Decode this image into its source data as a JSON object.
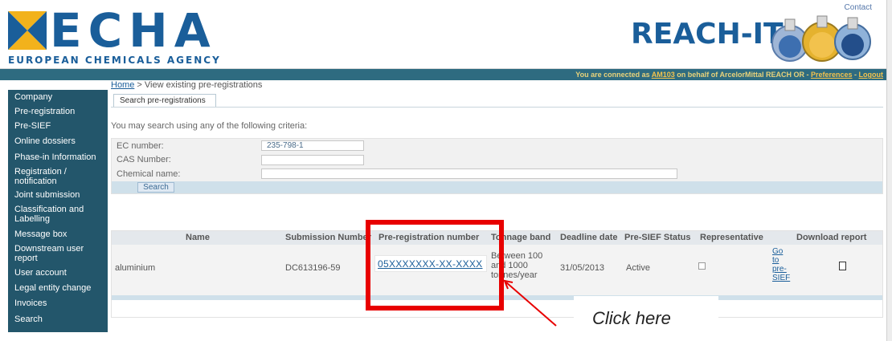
{
  "header": {
    "logo_text": "ECHA",
    "logo_subtitle": "EUROPEAN CHEMICALS AGENCY",
    "app_title": "REACH-IT",
    "contact_link": "Contact"
  },
  "connection": {
    "prefix": "You are connected as ",
    "user": "AM103",
    "middle": " on behalf of ArcelorMittal REACH OR - ",
    "preferences": "Preferences",
    "sep": " - ",
    "logout": "Logout"
  },
  "sidebar": {
    "items": [
      {
        "label": "Company",
        "lines": 1
      },
      {
        "label": "Pre-registration",
        "lines": 1
      },
      {
        "label": "Pre-SIEF",
        "lines": 1
      },
      {
        "label": "Online dossiers",
        "lines": 1
      },
      {
        "label": "Phase-in Information",
        "lines": 1
      },
      {
        "label": "Registration / notification",
        "lines": 2
      },
      {
        "label": "Joint submission",
        "lines": 1
      },
      {
        "label": "Classification and Labelling",
        "lines": 2
      },
      {
        "label": "Message box",
        "lines": 1
      },
      {
        "label": "Downstream user report",
        "lines": 2
      },
      {
        "label": "User account",
        "lines": 1
      },
      {
        "label": "Legal entity change",
        "lines": 1
      },
      {
        "label": "Invoices",
        "lines": 1
      },
      {
        "label": "Search",
        "lines": 1
      }
    ]
  },
  "breadcrumb": {
    "home": "Home",
    "sep": " > ",
    "current": "View existing pre-registrations"
  },
  "tab": {
    "label": "Search pre-registrations"
  },
  "intro": "You may search using any of the following criteria:",
  "form": {
    "ec_label": "EC number:",
    "ec_value": "235-798-1",
    "cas_label": "CAS Number:",
    "cas_value": "",
    "name_label": "Chemical name:",
    "name_value": "",
    "search_button": "Search"
  },
  "results": {
    "headers": {
      "name": "Name",
      "submission": "Submission Number",
      "prereg": "Pre-registration number",
      "tonnage": "Tonnage band",
      "deadline": "Deadline date",
      "presief": "Pre-SIEF Status",
      "representative": "Representative",
      "download": "Download report"
    },
    "row": {
      "name": "aluminium",
      "submission": "DC613196-59",
      "prereg": "05XXXXXXX-XX-XXXX",
      "tonnage_1": "Between 100",
      "tonnage_2": "and 1000",
      "tonnage_3": "tonnes/year",
      "deadline": "31/05/2013",
      "presief": "Active",
      "go_1": "Go",
      "go_2": "to",
      "go_3": "pre-",
      "go_4": "SIEF"
    }
  },
  "annotation": {
    "callout": "Click here",
    "highlight_color": "#e80000"
  },
  "colors": {
    "brand": "#1a5e9a",
    "sidebar": "#23566b",
    "bar": "#2e6b80"
  }
}
